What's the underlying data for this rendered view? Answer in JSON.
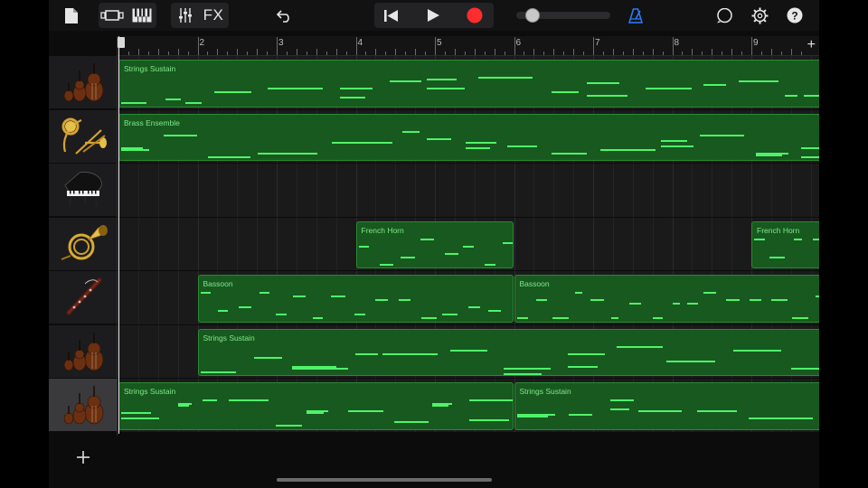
{
  "toolbar": {
    "fx_label": "FX",
    "icons": [
      "my-songs-icon",
      "track-view-icon",
      "keyboard-icon",
      "mixer-icon",
      "undo-icon",
      "go-to-beginning-icon",
      "play-icon",
      "record-icon",
      "metronome-icon",
      "loop-browser-icon",
      "settings-icon",
      "help-icon"
    ],
    "master_volume": 0.16,
    "colors": {
      "record": "#ff2d2d",
      "metronome": "#2f7bff"
    }
  },
  "ruler": {
    "bars": [
      "1",
      "2",
      "3",
      "4",
      "5",
      "6",
      "7",
      "8",
      "9"
    ],
    "add_label": "+"
  },
  "tracks": [
    {
      "instrument": "strings-icon",
      "selected": false,
      "regions": [
        {
          "name": "Strings Sustain",
          "start": 1,
          "end": 10
        }
      ]
    },
    {
      "instrument": "brass-icon",
      "selected": false,
      "regions": [
        {
          "name": "Brass Ensemble",
          "start": 1,
          "end": 10
        }
      ]
    },
    {
      "instrument": "grand-piano-icon",
      "selected": false,
      "regions": []
    },
    {
      "instrument": "french-horn-icon",
      "selected": false,
      "regions": [
        {
          "name": "French Horn",
          "start": 4,
          "end": 6
        },
        {
          "name": "French Horn",
          "start": 9,
          "end": 10
        }
      ]
    },
    {
      "instrument": "bassoon-icon",
      "selected": false,
      "regions": [
        {
          "name": "Bassoon",
          "start": 2,
          "end": 6
        },
        {
          "name": "Bassoon",
          "start": 6,
          "end": 10
        }
      ]
    },
    {
      "instrument": "strings-icon",
      "selected": false,
      "regions": [
        {
          "name": "Strings Sustain",
          "start": 2,
          "end": 10
        }
      ]
    },
    {
      "instrument": "strings-icon",
      "selected": true,
      "regions": [
        {
          "name": "Strings Sustain",
          "start": 1,
          "end": 6
        },
        {
          "name": "Strings Sustain",
          "start": 6,
          "end": 10
        }
      ]
    }
  ],
  "add_track_label": "+",
  "colors": {
    "region_fill": "#18591f",
    "region_border": "#2a8a33",
    "note": "#4ff36a",
    "region_label": "#7fe88a"
  }
}
